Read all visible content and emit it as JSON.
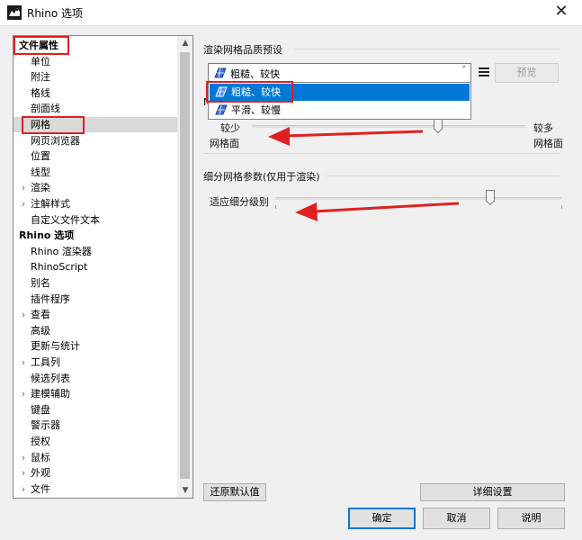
{
  "window": {
    "title": "Rhino 选项",
    "close_glyph": "✕"
  },
  "tree": {
    "items": [
      {
        "label": "文件属性",
        "root": true,
        "arrow": ""
      },
      {
        "label": "单位",
        "arrow": ""
      },
      {
        "label": "附注",
        "arrow": ""
      },
      {
        "label": "格线",
        "arrow": ""
      },
      {
        "label": "剖面线",
        "arrow": ""
      },
      {
        "label": "网格",
        "arrow": "",
        "selected": true
      },
      {
        "label": "网页浏览器",
        "arrow": ""
      },
      {
        "label": "位置",
        "arrow": ""
      },
      {
        "label": "线型",
        "arrow": ""
      },
      {
        "label": "渲染",
        "arrow": "›"
      },
      {
        "label": "注解样式",
        "arrow": "›"
      },
      {
        "label": "自定义文件文本",
        "arrow": ""
      },
      {
        "label": "Rhino 选项",
        "root": true,
        "arrow": ""
      },
      {
        "label": "Rhino 渲染器",
        "arrow": ""
      },
      {
        "label": "RhinoScript",
        "arrow": ""
      },
      {
        "label": "别名",
        "arrow": ""
      },
      {
        "label": "插件程序",
        "arrow": ""
      },
      {
        "label": "查看",
        "arrow": "›"
      },
      {
        "label": "高级",
        "arrow": ""
      },
      {
        "label": "更新与统计",
        "arrow": ""
      },
      {
        "label": "工具列",
        "arrow": "›"
      },
      {
        "label": "候选列表",
        "arrow": ""
      },
      {
        "label": "建模辅助",
        "arrow": "›"
      },
      {
        "label": "键盘",
        "arrow": ""
      },
      {
        "label": "警示器",
        "arrow": ""
      },
      {
        "label": "授权",
        "arrow": ""
      },
      {
        "label": "鼠标",
        "arrow": "›"
      },
      {
        "label": "外观",
        "arrow": "›"
      },
      {
        "label": "文件",
        "arrow": "›"
      }
    ],
    "scroll_up": "▲",
    "scroll_down": "▼"
  },
  "render_mesh": {
    "section_title": "渲染网格品质预设",
    "selected_value": "粗糙、较快",
    "caret": "˅",
    "preview_button": "预览",
    "options": [
      "粗糙、较快",
      "平滑、较慢"
    ],
    "highlighted_index": 0,
    "hidden_label_fragment": "N",
    "slider_left_top": "较少",
    "slider_left_bottom": "网格面",
    "slider_right_top": "较多",
    "slider_right_bottom": "网格面",
    "slider_fraction": 0.68
  },
  "subdivision": {
    "section_title": "细分网格参数(仅用于渲染)",
    "adaptive_label": "适应细分级别",
    "slider_fraction": 0.75
  },
  "buttons": {
    "restore_defaults": "还原默认值",
    "details": "详细设置",
    "ok": "确定",
    "cancel": "取消",
    "help": "说明"
  },
  "colors": {
    "annotation_red": "#e02020",
    "highlight_blue": "#0078d7"
  }
}
